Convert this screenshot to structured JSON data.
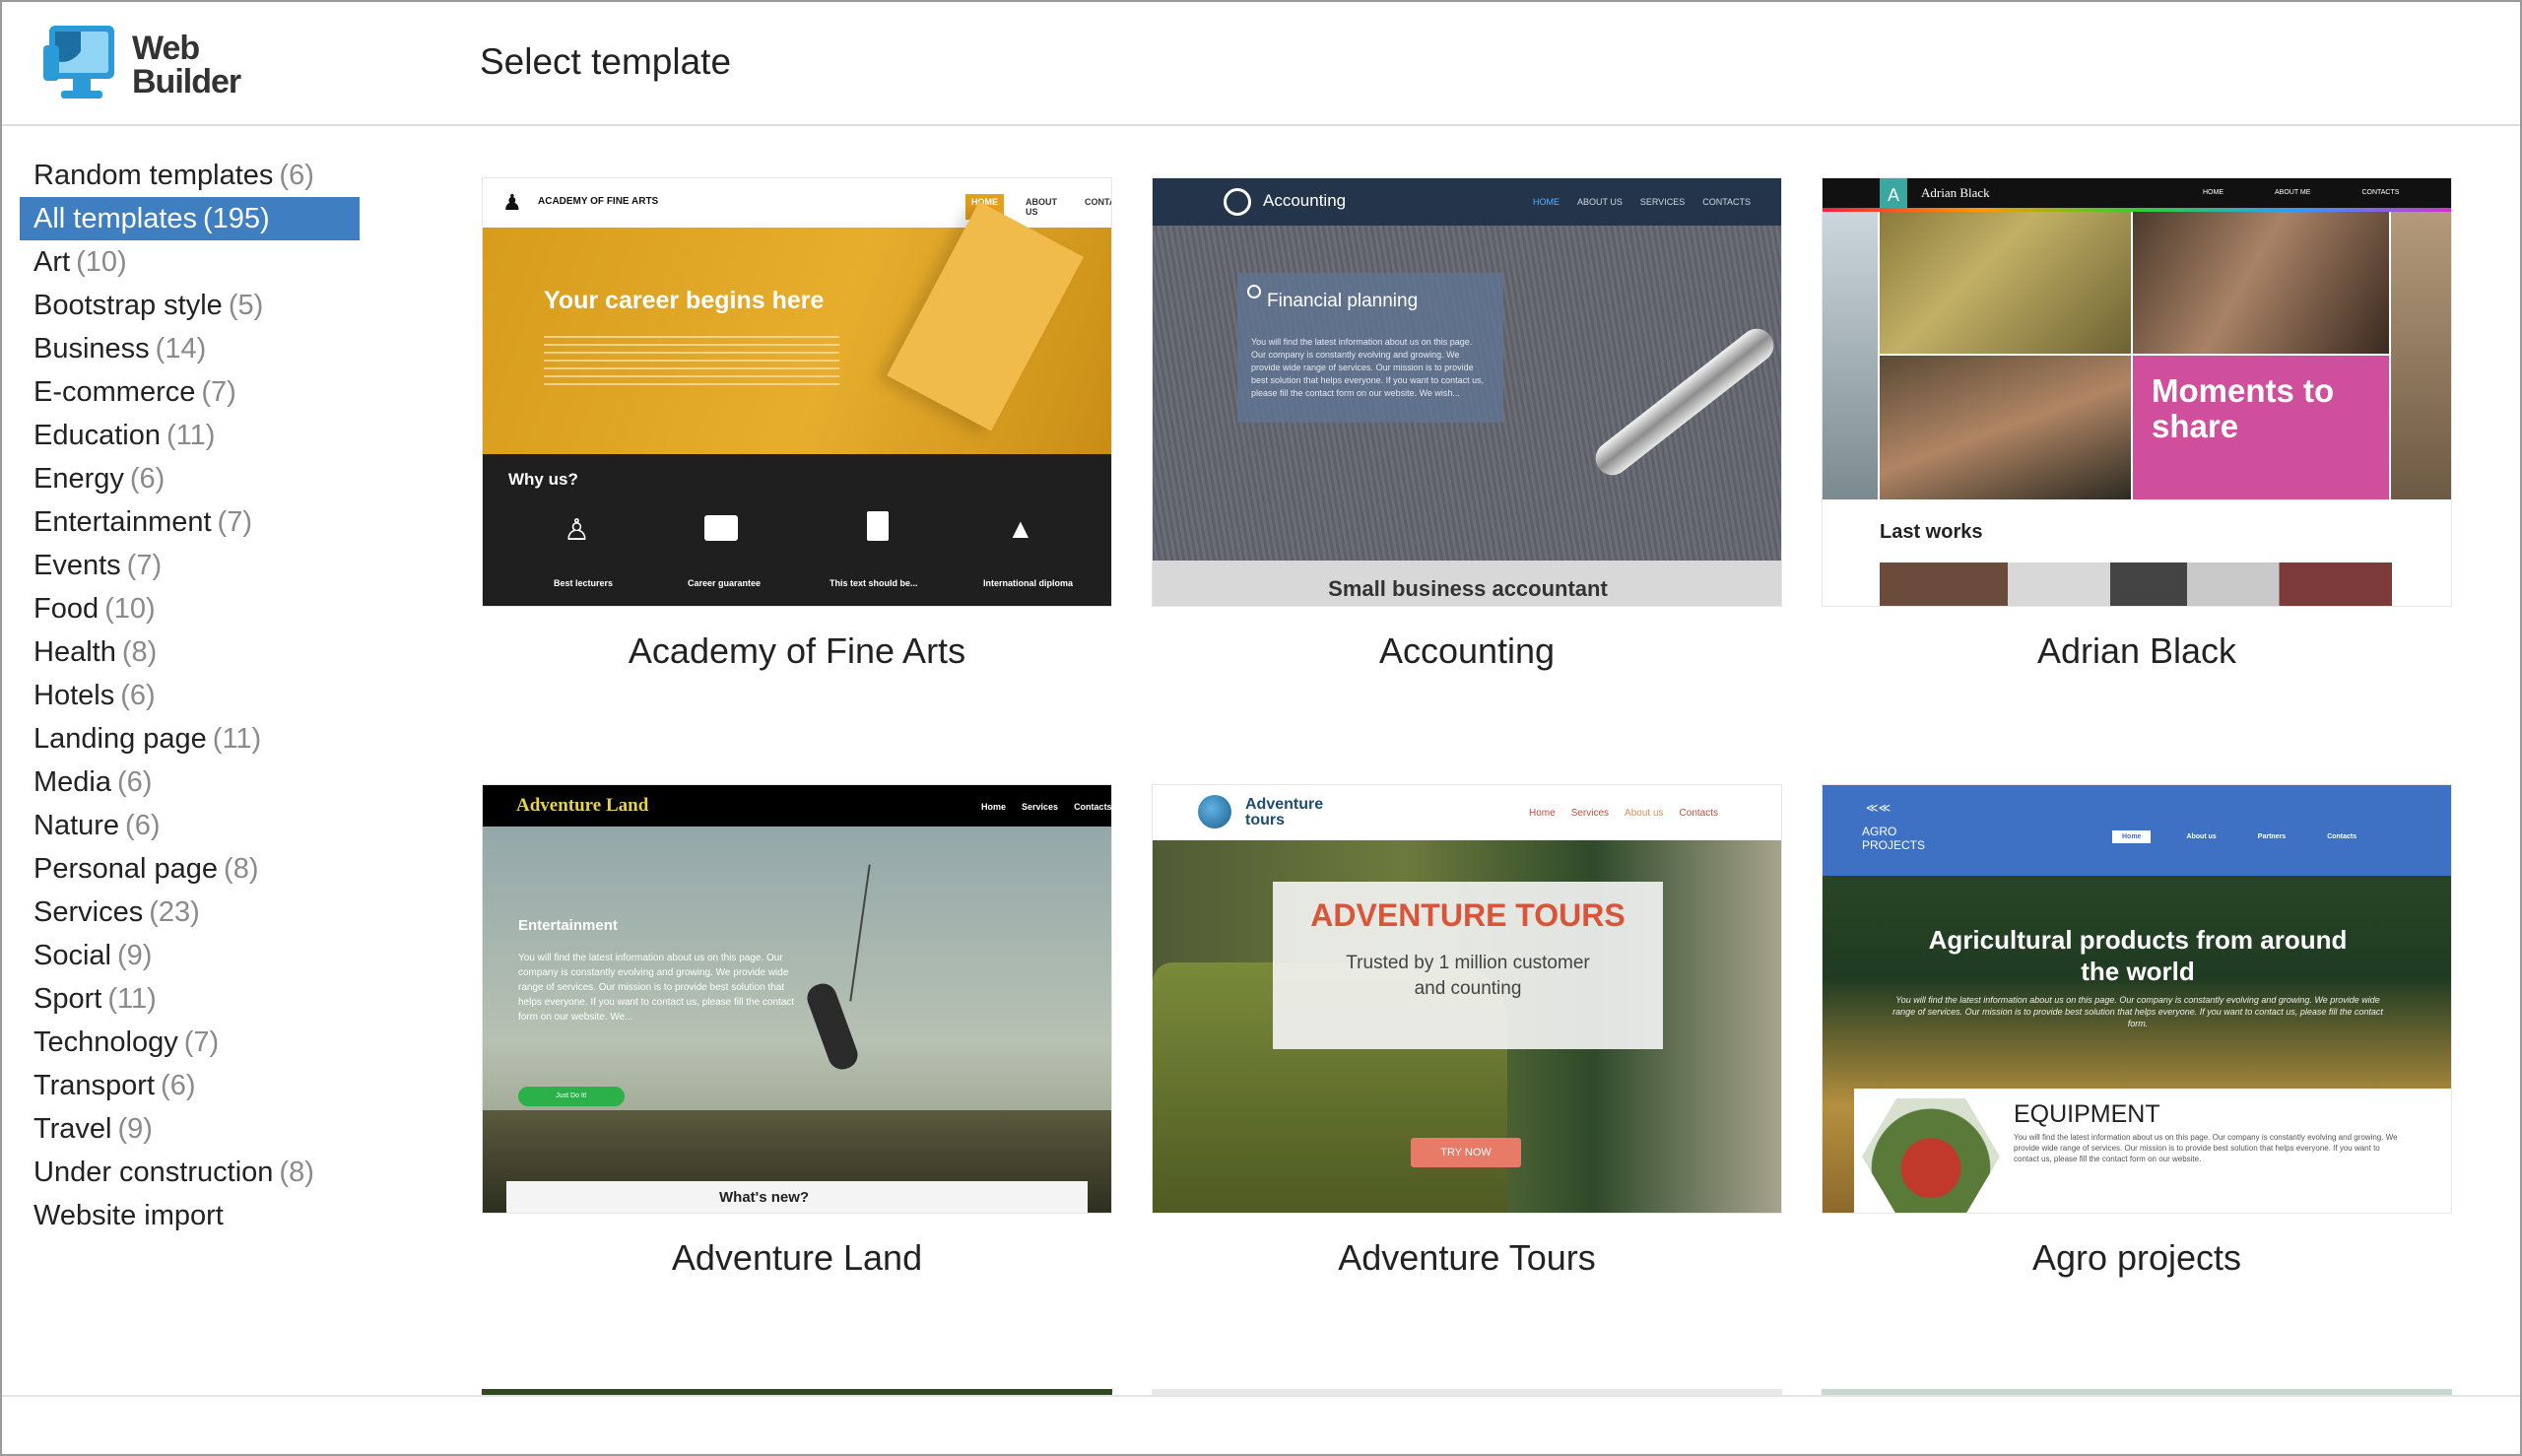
{
  "app": {
    "logo_line1": "Web",
    "logo_line2": "Builder",
    "page_title": "Select template"
  },
  "categories": [
    {
      "label": "Random templates",
      "count": "(6)"
    },
    {
      "label": "All templates",
      "count": "(195)"
    },
    {
      "label": "Art",
      "count": "(10)"
    },
    {
      "label": "Bootstrap style",
      "count": "(5)"
    },
    {
      "label": "Business",
      "count": "(14)"
    },
    {
      "label": "E-commerce",
      "count": "(7)"
    },
    {
      "label": "Education",
      "count": "(11)"
    },
    {
      "label": "Energy",
      "count": "(6)"
    },
    {
      "label": "Entertainment",
      "count": "(7)"
    },
    {
      "label": "Events",
      "count": "(7)"
    },
    {
      "label": "Food",
      "count": "(10)"
    },
    {
      "label": "Health",
      "count": "(8)"
    },
    {
      "label": "Hotels",
      "count": "(6)"
    },
    {
      "label": "Landing page",
      "count": "(11)"
    },
    {
      "label": "Media",
      "count": "(6)"
    },
    {
      "label": "Nature",
      "count": "(6)"
    },
    {
      "label": "Personal page",
      "count": "(8)"
    },
    {
      "label": "Services",
      "count": "(23)"
    },
    {
      "label": "Social",
      "count": "(9)"
    },
    {
      "label": "Sport",
      "count": "(11)"
    },
    {
      "label": "Technology",
      "count": "(7)"
    },
    {
      "label": "Transport",
      "count": "(6)"
    },
    {
      "label": "Travel",
      "count": "(9)"
    },
    {
      "label": "Under construction",
      "count": "(8)"
    },
    {
      "label": "Website import",
      "count": ""
    }
  ],
  "active_category_index": 1,
  "templates": [
    {
      "name": "Academy of Fine Arts",
      "thumb": {
        "brand": "ACADEMY OF FINE ARTS",
        "nav": [
          "HOME",
          "ABOUT US",
          "CONTACTS"
        ],
        "hero": "Your career begins here",
        "section": "Why us?",
        "features": [
          "Best lecturers",
          "Career guarantee",
          "This text should be...",
          "International diploma"
        ]
      }
    },
    {
      "name": "Accounting",
      "thumb": {
        "brand": "Accounting",
        "nav": [
          "HOME",
          "ABOUT US",
          "SERVICES",
          "CONTACTS"
        ],
        "card_title": "Financial planning",
        "card_text": "You will find the latest information about us on this page. Our company is constantly evolving and growing. We provide wide range of services. Our mission is to provide best solution that helps everyone. If you want to contact us, please fill the contact form on our website. We wish...",
        "footer": "Small business accountant"
      }
    },
    {
      "name": "Adrian Black",
      "thumb": {
        "brand": "Adrian Black",
        "nav": [
          "HOME",
          "ABOUT ME",
          "CONTACTS"
        ],
        "tile_text": "Moments to share",
        "section": "Last works"
      }
    },
    {
      "name": "Adventure Land",
      "thumb": {
        "brand": "Adventure Land",
        "nav": [
          "Home",
          "Services",
          "Contacts"
        ],
        "heading": "Entertainment",
        "text": "You will find the latest information about us on this page. Our company is constantly evolving and growing. We provide wide range of services. Our mission is to provide best solution that helps everyone. If you want to contact us, please fill the contact form on our website. We...",
        "button": "Just Do It!",
        "footer": "What's new?"
      }
    },
    {
      "name": "Adventure Tours",
      "thumb": {
        "brand_line1": "Adventure",
        "brand_line2": "tours",
        "nav": [
          "Home",
          "Services",
          "About us",
          "Contacts"
        ],
        "hero": "ADVENTURE TOURS",
        "sub_line1": "Trusted by 1 million customer",
        "sub_line2": "and counting",
        "button": "TRY NOW"
      }
    },
    {
      "name": "Agro projects",
      "thumb": {
        "brand_line1": "AGRO",
        "brand_line2": "PROJECTS",
        "nav": [
          "Home",
          "About us",
          "Partners",
          "Contacts"
        ],
        "hero_line1": "Agricultural products from around",
        "hero_line2": "the world",
        "hero_text": "You will find the latest information about us on this page. Our company is constantly evolving and growing. We provide wide range of services. Our mission is to provide best solution that helps everyone. If you want to contact us, please fill the contact form.",
        "card_title": "EQUIPMENT",
        "card_text": "You will find the latest information about us on this page. Our company is constantly evolving and growing. We provide wide range of services. Our mission is to provide best solution that helps everyone. If you want to contact us, please fill the contact form on our website."
      }
    }
  ],
  "colors": {
    "active_bg": "#3f7fc1",
    "count_gray": "#8a8a8a",
    "logo_blue": "#2a9bd6"
  }
}
